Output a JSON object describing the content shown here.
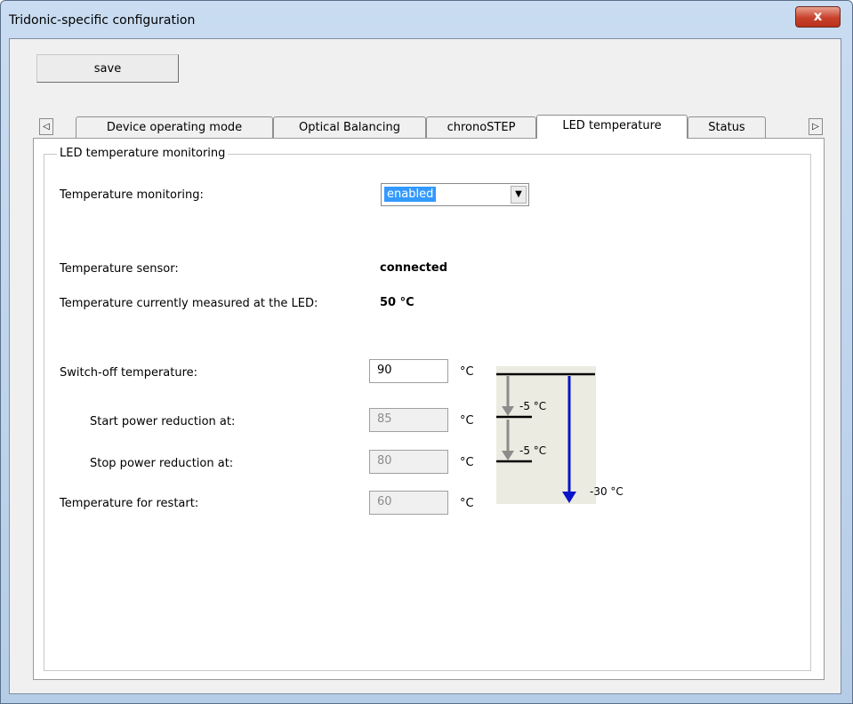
{
  "window": {
    "title": "Tridonic-specific configuration",
    "close_glyph": "x"
  },
  "toolbar": {
    "save_label": "save"
  },
  "tab_scroll": {
    "left_glyph": "◁",
    "right_glyph": "▷"
  },
  "tabs": [
    {
      "label": "Device operating mode",
      "active": false
    },
    {
      "label": "Optical Balancing",
      "active": false
    },
    {
      "label": "chronoSTEP",
      "active": false
    },
    {
      "label": "LED temperature",
      "active": true
    },
    {
      "label": "Status",
      "active": false
    }
  ],
  "group": {
    "title": "LED temperature  monitoring"
  },
  "monitoring": {
    "label": "Temperature monitoring:",
    "value": "enabled",
    "drop_glyph": "▼"
  },
  "sensor": {
    "label": "Temperature sensor:",
    "value": "connected"
  },
  "measured": {
    "label": "Temperature currently measured at the LED:",
    "value": "50 °C"
  },
  "switch_off": {
    "label": "Switch-off temperature:",
    "value": "90",
    "unit": "°C"
  },
  "start_reduction": {
    "label": "Start power reduction at:",
    "value": "85",
    "unit": "°C"
  },
  "stop_reduction": {
    "label": "Stop power reduction at:",
    "value": "80",
    "unit": "°C"
  },
  "restart": {
    "label": "Temperature for restart:",
    "value": "60",
    "unit": "°C"
  },
  "diagram": {
    "step1_label": "-5 °C",
    "step2_label": "-5 °C",
    "total_label": "-30 °C",
    "gray_arrow_color": "#8c8c8c",
    "blue_arrow_color": "#0a14c8"
  }
}
